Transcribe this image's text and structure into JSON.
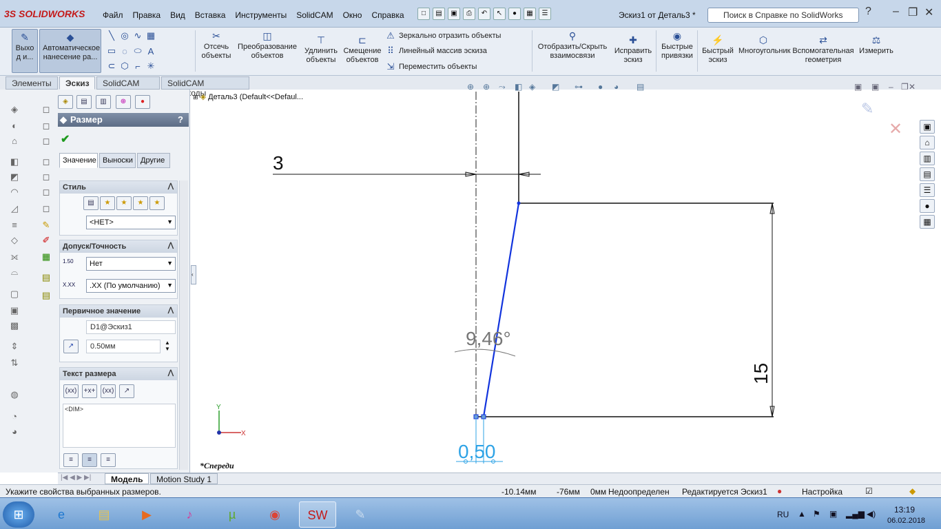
{
  "app": {
    "logo": "SOLIDWORKS",
    "logo_prefix": "3S",
    "doc_title": "Эскиз1 от Деталь3 *",
    "search_placeholder": "Поиск в Справке по SolidWorks"
  },
  "menu": [
    "Файл",
    "Правка",
    "Вид",
    "Вставка",
    "Инструменты",
    "SolidCAM",
    "Окно",
    "Справка"
  ],
  "ribbon": {
    "exit": "Выхо д и...",
    "auto_dim": "Автоматическое нанесение ра...",
    "trim": "Отсечь объекты",
    "convert": "Преобразование объектов",
    "extend": "Удлинить объекты",
    "offset": "Смещение объектов",
    "mirror": "Зеркально отразить объекты",
    "linear": "Линейный массив эскиза",
    "move": "Переместить объекты",
    "show_rel": "Отобразить/Скрыть взаимосвязи",
    "repair": "Исправить эскиз",
    "snaps": "Быстрые привязки",
    "rapid": "Быстрый эскиз",
    "polygon": "Многоугольник",
    "construct": "Вспомогательная геометрия",
    "measure": "Измерить"
  },
  "cmtabs": [
    "Элементы",
    "Эскиз",
    "SolidCAM Part",
    "SolidCAM Переходы"
  ],
  "pm": {
    "title": "Размер",
    "help": "?",
    "tabs": [
      "Значение",
      "Выноски",
      "Другие"
    ],
    "style": {
      "title": "Стиль",
      "value": "<НЕТ>"
    },
    "tol": {
      "title": "Допуск/Точность",
      "tol_value": "Нет",
      "prec_value": ".XX (По умолчанию)",
      "tol_icon": "1.50",
      "prec_icon": "X.XX"
    },
    "primary": {
      "title": "Первичное значение",
      "name": "D1@Эскиз1",
      "value": "0.50мм"
    },
    "text": {
      "title": "Текст размера",
      "content": "<DIM>",
      "btns": [
        "(xx)",
        "+x+",
        "(xx)"
      ]
    }
  },
  "tree": {
    "item": "Деталь3  (Default<<Defaul..."
  },
  "canvas": {
    "dim_top": "3",
    "dim_angle": "9,46°",
    "dim_right": "15",
    "dim_bottom": "0,50",
    "view_label": "*Спереди",
    "axis_y": "Y",
    "axis_x": "X"
  },
  "btabs": [
    "Модель",
    "Motion Study 1"
  ],
  "status": {
    "msg": "Укажите свойства выбранных размеров.",
    "x": "-10.14мм",
    "y": "-76мм",
    "z": "0мм",
    "state": "Недоопределен",
    "editing": "Редактируется Эскиз1",
    "custom": "Настройка"
  },
  "taskbar": {
    "lang": "RU",
    "time": "13:19",
    "date": "06.02.2018"
  },
  "colors": {
    "accent": "#2a4f96",
    "sketch_blue": "#1133dd",
    "dim_blue": "#2ea3e6"
  }
}
